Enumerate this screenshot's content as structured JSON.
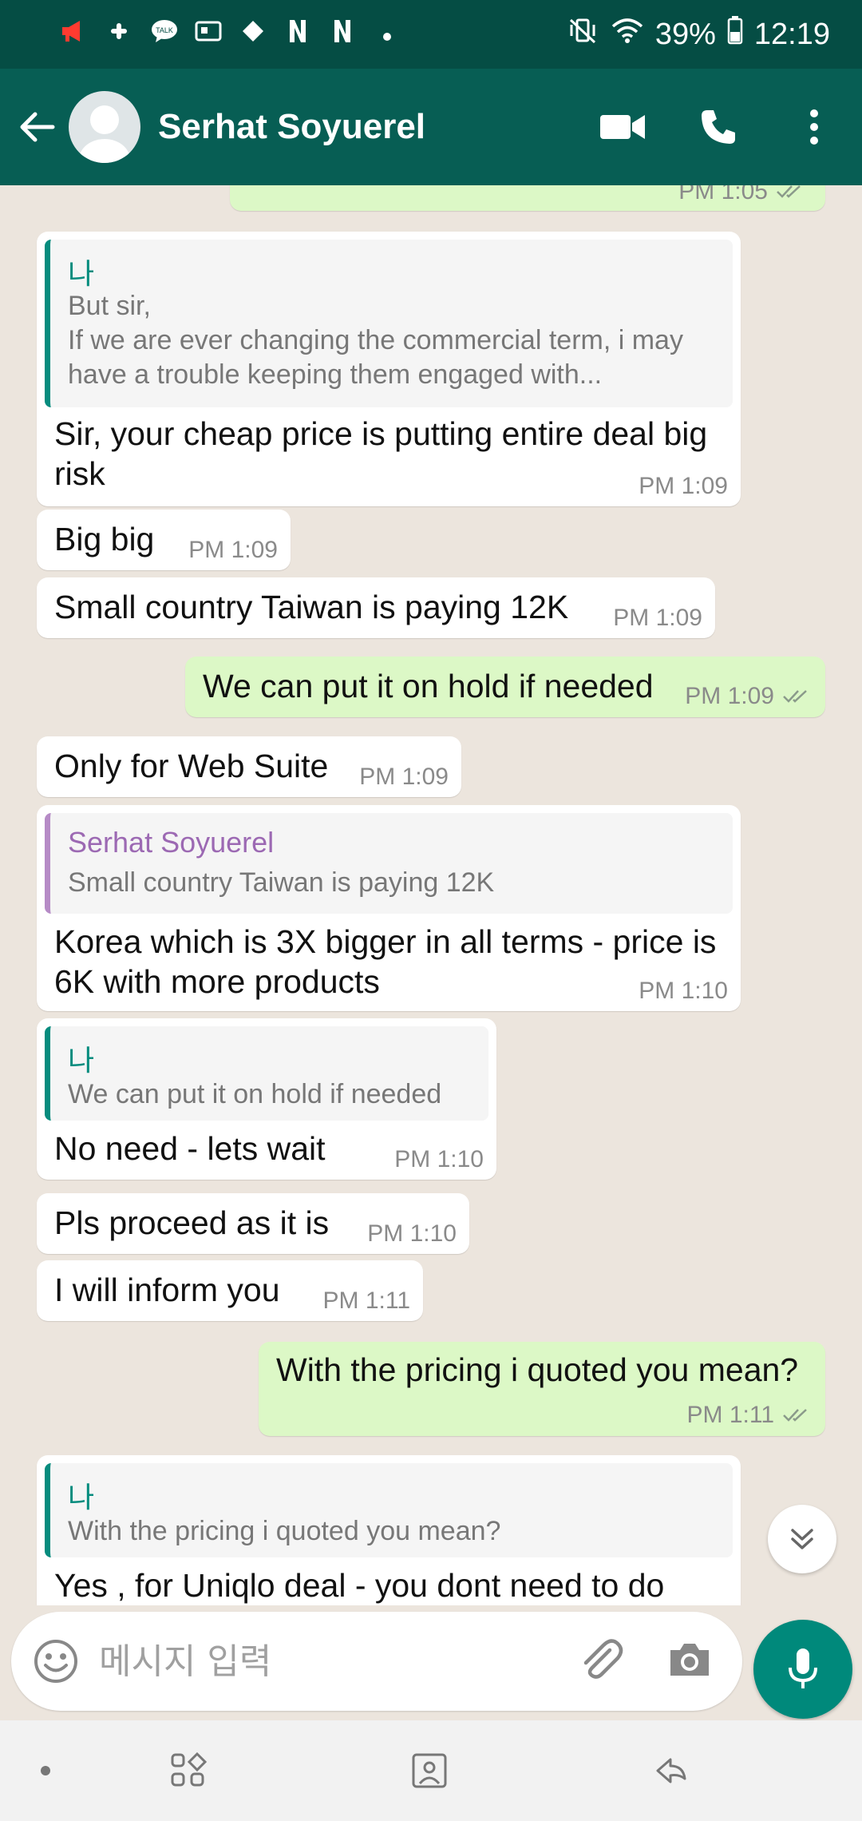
{
  "status_bar": {
    "battery": "39%",
    "time": "12:19",
    "left_icons": [
      "megaphone-icon",
      "slack-icon",
      "kakaotalk-icon",
      "gallery-icon",
      "diamond-icon",
      "n-icon",
      "n-icon",
      "dot-icon"
    ],
    "talk_label": "TALK"
  },
  "header": {
    "contact_name": "Serhat Soyuerel"
  },
  "colors": {
    "header": "#075e54",
    "status_bar": "#054d44",
    "outgoing_bubble": "#dcf8c6",
    "incoming_bubble": "#ffffff",
    "accent": "#00897b",
    "quote_self": "#068c7e",
    "quote_contact": "#9c69b3"
  },
  "messages": [
    {
      "id": "m0",
      "direction": "out",
      "text": "",
      "time": "PM 1:05",
      "read": true
    },
    {
      "id": "m1",
      "direction": "in",
      "quote": {
        "author": "나",
        "text": "But sir,\nIf we are ever changing the commercial term, i may have a trouble keeping them engaged with..."
      },
      "text": "Sir, your cheap price is putting entire deal big risk",
      "time": "PM 1:09"
    },
    {
      "id": "m2",
      "direction": "in",
      "text": "Big big",
      "time": "PM 1:09"
    },
    {
      "id": "m3",
      "direction": "in",
      "text": "Small country Taiwan is paying 12K",
      "time": "PM 1:09"
    },
    {
      "id": "m4",
      "direction": "out",
      "text": "We can put it on hold if needed",
      "time": "PM 1:09",
      "read": true
    },
    {
      "id": "m5",
      "direction": "in",
      "text": "Only for Web Suite",
      "time": "PM 1:09"
    },
    {
      "id": "m6",
      "direction": "in",
      "quote": {
        "author": "Serhat Soyuerel",
        "text": "Small country Taiwan is paying 12K"
      },
      "text": "Korea which is 3X bigger in all terms - price is 6K with more products",
      "time": "PM 1:10"
    },
    {
      "id": "m7",
      "direction": "in",
      "quote": {
        "author": "나",
        "text": "We can put it on hold if needed"
      },
      "text": "No need - lets wait",
      "time": "PM 1:10"
    },
    {
      "id": "m8",
      "direction": "in",
      "text": "Pls proceed as it is",
      "time": "PM 1:10"
    },
    {
      "id": "m9",
      "direction": "in",
      "text": "I will inform you",
      "time": "PM 1:11"
    },
    {
      "id": "m10",
      "direction": "out",
      "text": "With the pricing i quoted you mean?",
      "time": "PM 1:11",
      "read": true
    },
    {
      "id": "m11",
      "direction": "in",
      "quote": {
        "author": "나",
        "text": "With the pricing i quoted you mean?"
      },
      "text": "Yes , for Uniqlo deal - you dont need to do",
      "time": ""
    }
  ],
  "composer": {
    "placeholder": "메시지 입력"
  }
}
